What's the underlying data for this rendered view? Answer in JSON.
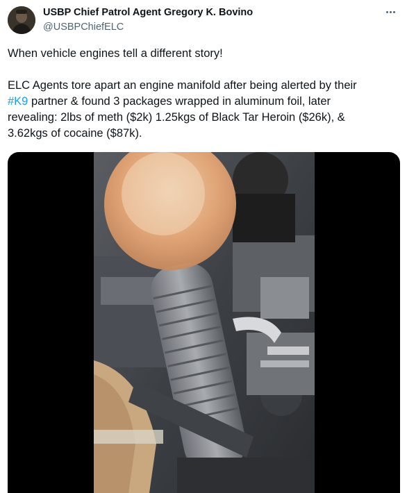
{
  "author": {
    "display_name": "USBP Chief Patrol Agent Gregory K. Bovino",
    "handle": "@USBPChiefELC"
  },
  "tweet": {
    "line1": "When vehicle engines tell a different story!",
    "body_line1": "ELC Agents tore apart an engine manifold after being alerted by their",
    "hashtag": "#K9",
    "body_line2_rest": " partner & found 3 packages wrapped in aluminum foil, later",
    "body_line3": "revealing: 2lbs of meth ($2k) 1.25kgs of Black Tar Heroin ($26k), &",
    "body_line4": "3.62kgs of cocaine ($87k)."
  },
  "icons": {
    "more": "more-options-icon",
    "avatar": "profile-avatar"
  },
  "colors": {
    "link": "#1d9bf0",
    "secondary_text": "#536471",
    "primary_text": "#0f1419"
  }
}
